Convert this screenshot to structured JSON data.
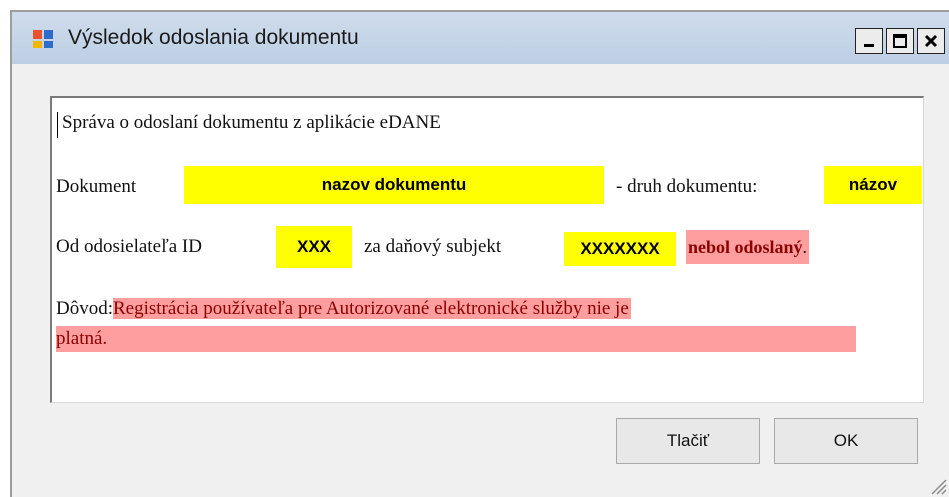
{
  "window": {
    "title": "Výsledok odoslania dokumentu",
    "controls": {
      "minimize": "_",
      "maximize": "□",
      "close": "X"
    }
  },
  "message": {
    "header": "Správa o odoslaní dokumentu z aplikácie eDANE",
    "line1": {
      "prefix": "Dokument",
      "document_name": "nazov dokumentu",
      "middle": "- druh dokumentu:",
      "document_type": "názov"
    },
    "line2": {
      "prefix": "Od odosielateľa ID",
      "sender_id": "XXX",
      "middle": "za daňový subjekt",
      "subject": "XXXXXXX",
      "status": "nebol odoslaný",
      "suffix": "."
    },
    "line3": {
      "prefix": "Dôvod:",
      "reason_part1": "Registrácia používateľa pre Autorizované elektronické služby nie je",
      "reason_part2": "platná."
    }
  },
  "buttons": {
    "print": "Tlačiť",
    "ok": "OK"
  },
  "colors": {
    "highlight_yellow": "#ffff00",
    "highlight_red": "#ff9e9e",
    "titlebar": "#c8d7ea"
  }
}
